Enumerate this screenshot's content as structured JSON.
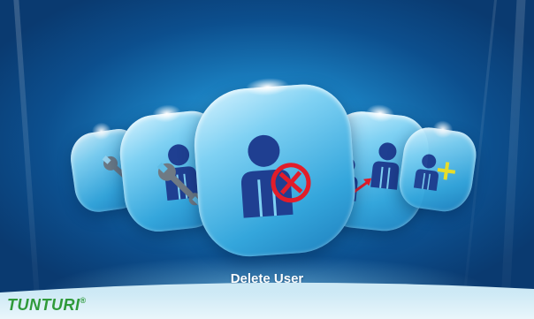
{
  "app": {
    "caption": "Delete User",
    "brand": "TUNTURI",
    "brand_mark": "®"
  },
  "carousel": {
    "items": [
      {
        "id": "settings",
        "icon": "wrench-icon"
      },
      {
        "id": "user-settings",
        "icon": "user-wrench-icon"
      },
      {
        "id": "delete-user",
        "icon": "user-delete-icon",
        "selected": true
      },
      {
        "id": "switch-user",
        "icon": "user-switch-icon"
      },
      {
        "id": "add-user",
        "icon": "user-add-icon"
      }
    ]
  },
  "colors": {
    "icon_blue": "#1f3f91",
    "delete_red": "#e21d2a",
    "switch_red": "#e21d2a",
    "add_yellow": "#f4e425",
    "wrench_gray": "#6f7a84",
    "brand_green": "#2f9a3a"
  }
}
